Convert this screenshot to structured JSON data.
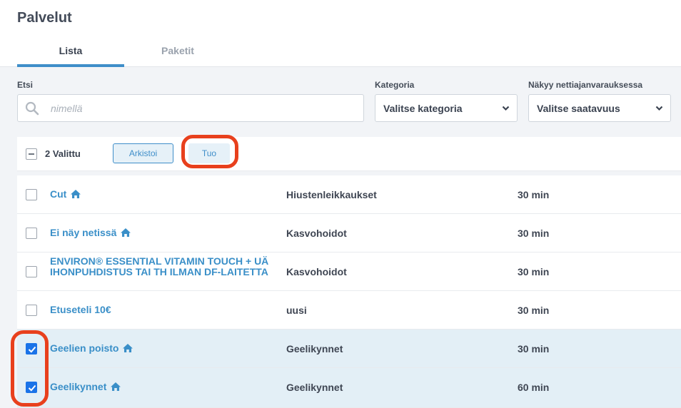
{
  "page": {
    "title": "Palvelut"
  },
  "tabs": [
    {
      "label": "Lista",
      "active": true
    },
    {
      "label": "Paketit",
      "active": false
    }
  ],
  "filters": {
    "search": {
      "label": "Etsi",
      "placeholder": "nimellä",
      "value": ""
    },
    "category": {
      "label": "Kategoria",
      "value": "Valitse kategoria"
    },
    "visibility": {
      "label": "Näkyy nettiajanvarauksessa",
      "value": "Valitse saatavuus"
    }
  },
  "bulk": {
    "selected_label": "2 Valittu",
    "archive_label": "Arkistoi",
    "import_label": "Tuo"
  },
  "services": [
    {
      "name": "Cut",
      "home_icon": true,
      "category": "Hiustenleikkaukset",
      "duration": "30 min",
      "checked": false
    },
    {
      "name": "Ei näy netissä",
      "home_icon": true,
      "category": "Kasvohoidot",
      "duration": "30 min",
      "checked": false
    },
    {
      "name": "ENVIRON® ESSENTIAL VITAMIN TOUCH + UÄ IHONPUHDISTUS TAI TH ILMAN DF-LAITETTA",
      "home_icon": false,
      "category": "Kasvohoidot",
      "duration": "30 min",
      "checked": false
    },
    {
      "name": "Etuseteli 10€",
      "home_icon": false,
      "category": "uusi",
      "duration": "30 min",
      "checked": false
    },
    {
      "name": "Geelien poisto",
      "home_icon": true,
      "category": "Geelikynnet",
      "duration": "30 min",
      "checked": true
    },
    {
      "name": "Geelikynnet",
      "home_icon": true,
      "category": "Geelikynnet",
      "duration": "60 min",
      "checked": true
    }
  ],
  "colors": {
    "accent": "#3f8ec9",
    "link": "#3a8fc8",
    "checkbox_checked": "#1a73e8",
    "selected_row": "#e3eff6",
    "annotation": "#e8401d"
  },
  "icons": {
    "search": "search-icon",
    "chevron": "chevron-down-icon",
    "home": "home-icon"
  }
}
